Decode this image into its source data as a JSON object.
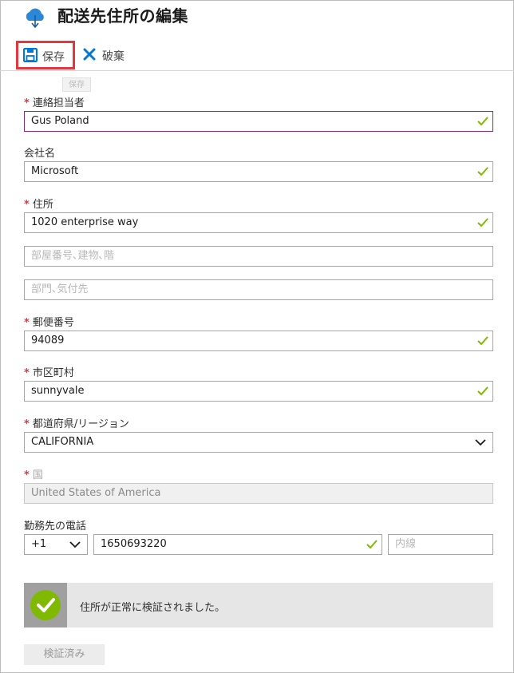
{
  "header": {
    "title": "配送先住所の編集",
    "icon": "cloud-upload-icon"
  },
  "toolbar": {
    "save_label": "保存",
    "discard_label": "破棄",
    "tooltip": "保存"
  },
  "colors": {
    "accent_blue": "#0078d4",
    "required_red": "#e5353e",
    "success_green": "#7fba00",
    "focus_border": "#8b2a6f"
  },
  "form": {
    "contact": {
      "label": "連絡担当者",
      "value": "Gus Poland",
      "required": true
    },
    "company": {
      "label": "会社名",
      "value": "Microsoft",
      "required": false
    },
    "address": {
      "label": "住所",
      "value": "1020 enterprise way",
      "required": true,
      "line2_placeholder": "部屋番号､建物､階",
      "line3_placeholder": "部門､気付先"
    },
    "postal": {
      "label": "郵便番号",
      "value": "94089",
      "required": true
    },
    "city": {
      "label": "市区町村",
      "value": "sunnyvale",
      "required": true
    },
    "state": {
      "label": "都道府県/リージョン",
      "value": "CALIFORNIA",
      "required": true
    },
    "country": {
      "label": "国",
      "value": "United States of America",
      "required": true
    },
    "phone": {
      "label": "勤務先の電話",
      "country_code": "+1",
      "number": "1650693220",
      "extension_placeholder": "内線"
    }
  },
  "verification": {
    "message": "住所が正常に検証されました。",
    "button_label": "検証済み"
  }
}
